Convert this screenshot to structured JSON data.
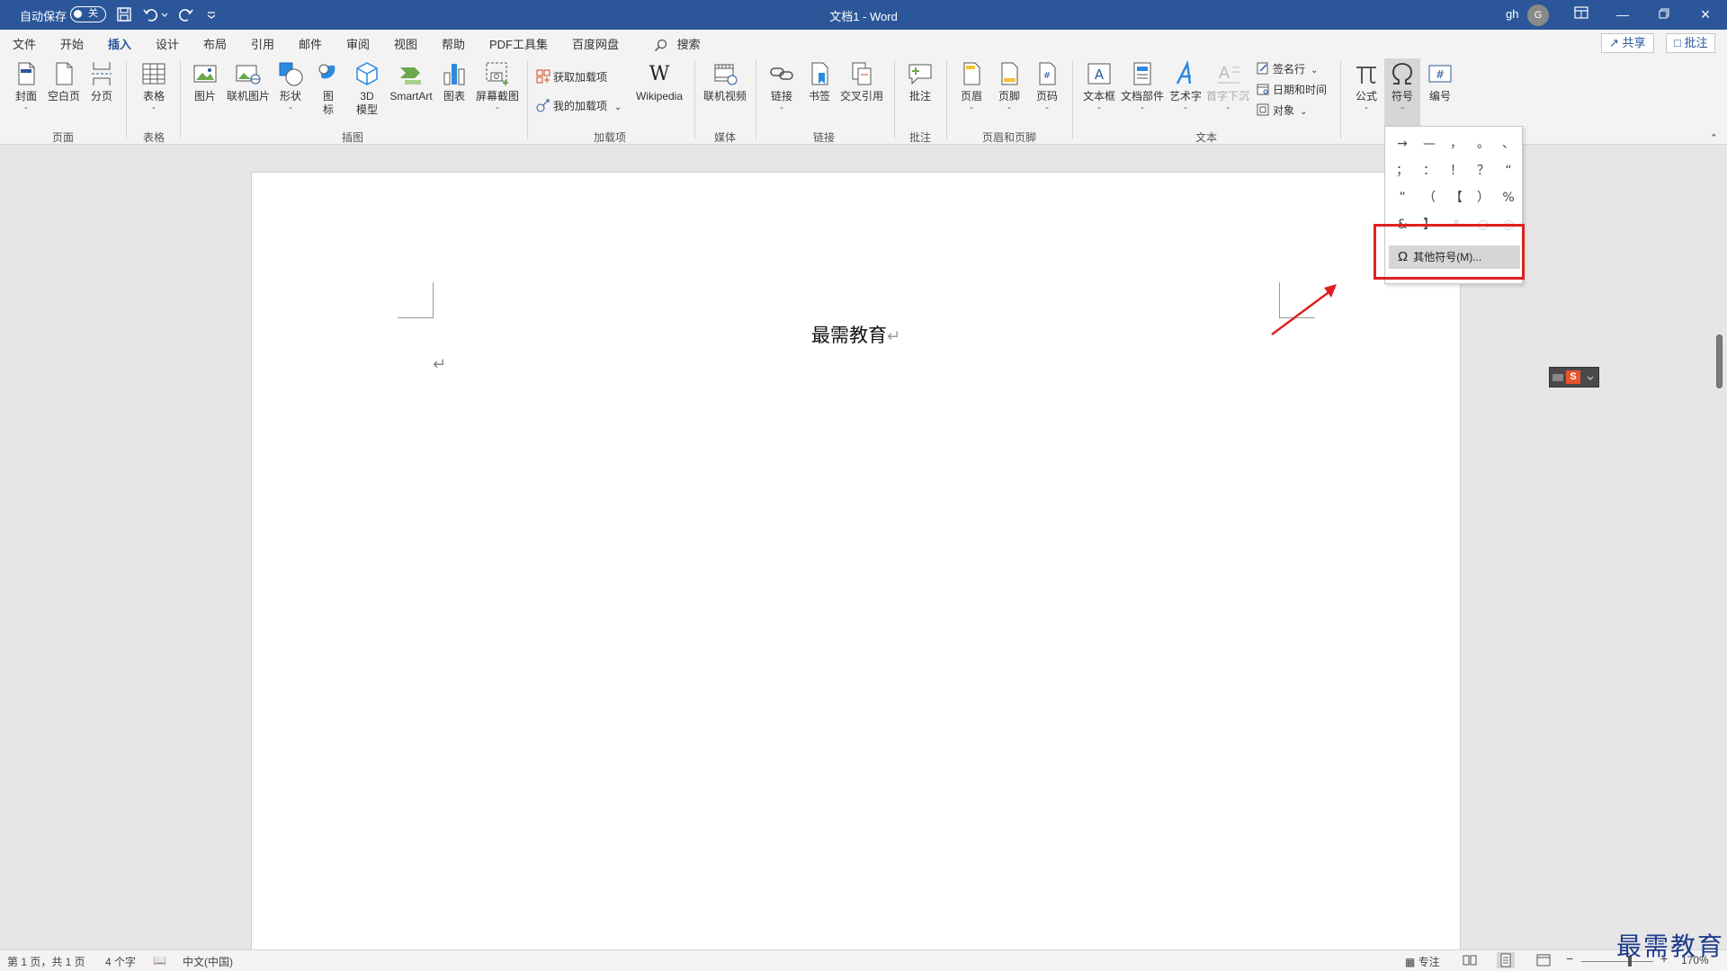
{
  "titlebar": {
    "autosave_label": "自动保存",
    "autosave_state": "关",
    "doc_title": "文档1 - Word",
    "user_name": "gh",
    "avatar_initial": "G"
  },
  "menu_tabs": [
    "文件",
    "开始",
    "插入",
    "设计",
    "布局",
    "引用",
    "邮件",
    "审阅",
    "视图",
    "帮助",
    "PDF工具集",
    "百度网盘"
  ],
  "active_tab": "插入",
  "search_label": "搜索",
  "share_label": "共享",
  "comments_label": "批注",
  "ribbon": {
    "pages": {
      "cover": "封面",
      "blank": "空白页",
      "break": "分页",
      "group": "页面"
    },
    "tables": {
      "table": "表格",
      "group": "表格"
    },
    "illustrations": {
      "picture": "图片",
      "online_picture": "联机图片",
      "shapes": "形状",
      "icons_l1": "图",
      "icons_l2": "标",
      "model_l1": "3D",
      "model_l2": "模型",
      "smartart": "SmartArt",
      "chart": "图表",
      "screenshot": "屏幕截图",
      "group": "插图"
    },
    "addins": {
      "get": "获取加载项",
      "mine": "我的加载项",
      "wikipedia": "Wikipedia",
      "group": "加载项"
    },
    "media": {
      "online_video": "联机视频",
      "group": "媒体"
    },
    "links": {
      "link": "链接",
      "bookmark": "书签",
      "cross_ref": "交叉引用",
      "group": "链接"
    },
    "comments": {
      "comment": "批注",
      "group": "批注"
    },
    "header_footer": {
      "header": "页眉",
      "footer": "页脚",
      "page_number": "页码",
      "group": "页眉和页脚"
    },
    "text": {
      "textbox": "文本框",
      "quick_parts": "文档部件",
      "wordart": "艺术字",
      "dropcap": "首字下沉",
      "signature": "签名行",
      "datetime": "日期和时间",
      "object": "对象",
      "group": "文本"
    },
    "symbols": {
      "equation": "公式",
      "symbol": "符号",
      "number": "编号"
    }
  },
  "symbol_panel": {
    "symbols": [
      "→",
      "—",
      "，",
      "。",
      "、",
      "；",
      "：",
      "！",
      "？",
      "“",
      "”",
      "（",
      "【",
      "）",
      "%",
      "&",
      "】",
      "*",
      "○",
      "◎"
    ],
    "more_label": "其他符号(M)..."
  },
  "document": {
    "heading": "最需教育",
    "para_mark": "↵"
  },
  "statusbar": {
    "page": "第 1 页，共 1 页",
    "words": "4 个字",
    "language": "中文(中国)",
    "focus": "专注",
    "zoom_minus": "−",
    "zoom_plus": "+",
    "zoom": "170%"
  },
  "watermark": "最需教育",
  "colors": {
    "accent": "#2b579a",
    "annotation_red": "#e02020"
  }
}
